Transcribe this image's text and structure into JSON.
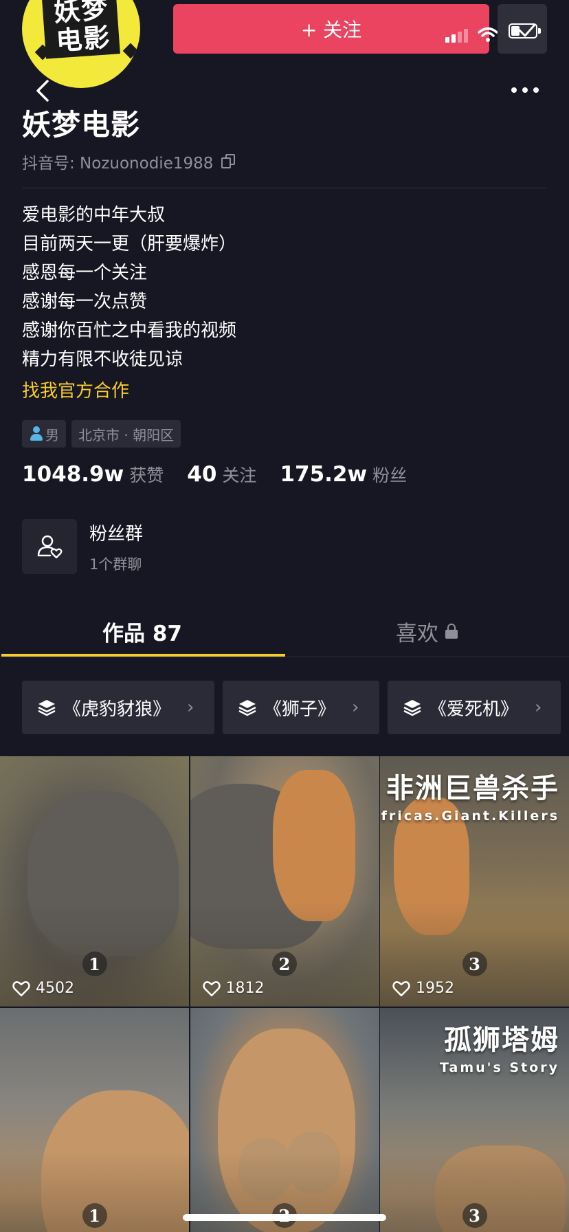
{
  "header": {
    "avatar_text": "妖梦电影",
    "follow_label": "+ 关注",
    "colors": {
      "follow": "#ea4461",
      "accent": "#f7cd2c",
      "background": "#161722"
    }
  },
  "profile": {
    "name": "妖梦电影",
    "douyin_id": "抖音号: Nozuonodie1988",
    "bio": [
      "爱电影的中年大叔",
      "目前两天一更（肝要爆炸）",
      "感恩每一个关注",
      "感谢每一次点赞",
      "感谢你百忙之中看我的视频",
      "精力有限不收徒见谅"
    ],
    "bio_link": "找我官方合作",
    "tags": {
      "gender": "男",
      "location": "北京市 · 朝阳区"
    }
  },
  "stats": [
    {
      "num": "1048.9w",
      "label": "获赞"
    },
    {
      "num": "40",
      "label": "关注"
    },
    {
      "num": "175.2w",
      "label": "粉丝"
    }
  ],
  "fan_group": {
    "title": "粉丝群",
    "subtitle": "1个群聊"
  },
  "tabs": {
    "works": "作品 87",
    "likes": "喜欢"
  },
  "collections": [
    "《虎豹豺狼》",
    "《狮子》",
    "《爱死机》"
  ],
  "videos": [
    {
      "rank": "1",
      "likes": "4502",
      "scene": "elephant"
    },
    {
      "rank": "2",
      "likes": "1812",
      "scene": "lion-attack"
    },
    {
      "rank": "3",
      "likes": "1952",
      "scene": "lion-attack",
      "title_cn": "非洲巨兽杀手",
      "title_en": "Africas.Giant.Killers"
    },
    {
      "rank": "1",
      "scene": "lioness"
    },
    {
      "rank": "2",
      "scene": "lioness-cubs"
    },
    {
      "rank": "3",
      "scene": "lion",
      "title_cn": "孤狮塔姆",
      "title_en": "Tamu's Story"
    }
  ]
}
